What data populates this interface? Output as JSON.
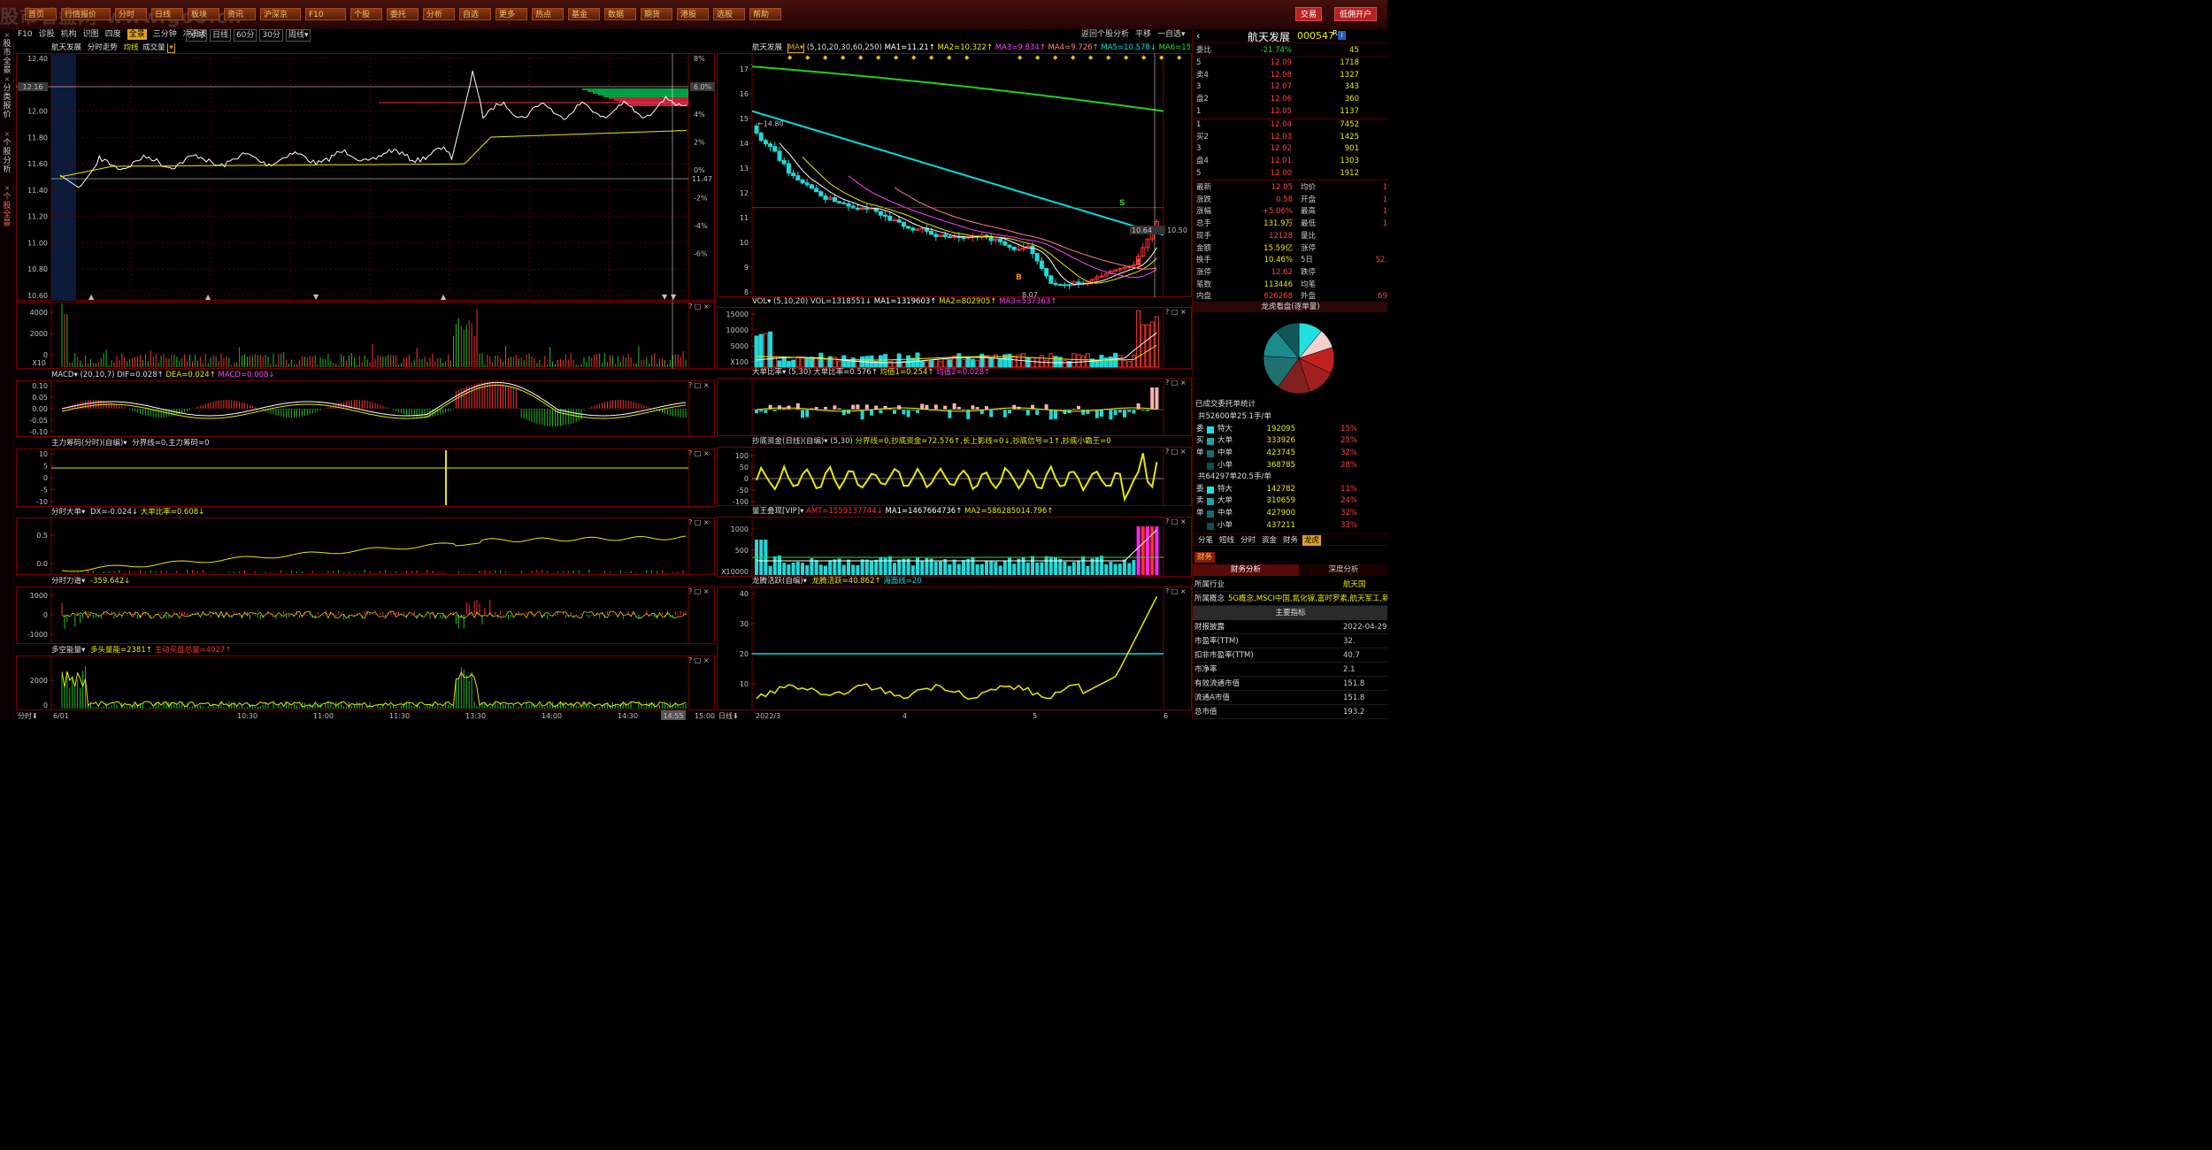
{
  "app": {
    "watermark": "股市看盘网-www.goo.cn",
    "trade_button": "交易",
    "open_account_button": "低佣开户"
  },
  "top_buttons": [
    "首页",
    "行情报价",
    "分时",
    "日线",
    "板块",
    "资讯",
    "沪深京",
    "F10",
    "个股",
    "委托",
    "分析",
    "自选",
    "更多",
    "热点",
    "基金",
    "数据",
    "期货",
    "港股",
    "选股",
    "帮助"
  ],
  "left_tabs": [
    {
      "label": "股市全景",
      "active": false
    },
    {
      "label": "分类报价",
      "active": false
    },
    {
      "label": "个股分析",
      "active": false
    },
    {
      "label": "个股全景",
      "active": true
    }
  ],
  "toolbar": {
    "items": [
      "F10",
      "诊股",
      "机构",
      "识图",
      "四度",
      "全景",
      "三分钟",
      "冲击波"
    ],
    "active": "全景",
    "tabs": [
      "分时",
      "日线",
      "60分",
      "30分",
      "周线▾"
    ],
    "right": [
      "返回个股分析",
      "平移",
      "一自选▾"
    ]
  },
  "intraday": {
    "header": {
      "name": "航天发展",
      "title": "分时走势",
      "avg_label": "均线",
      "vol_label": "成交量"
    },
    "price_ticks": [
      "12.40",
      "12.20",
      "12.00",
      "11.80",
      "11.60",
      "11.40",
      "11.20",
      "11.00",
      "10.80",
      "10.60"
    ],
    "pct_ticks": [
      "8%",
      "6%",
      "4%",
      "2%",
      "0%",
      "-2%",
      "-4%",
      "-6%"
    ],
    "cur_price_tag": "12.16",
    "cur_pct_tag": "6.0%",
    "prev_close_label": "11.47",
    "vol_ticks": [
      "4000",
      "2000",
      "0"
    ],
    "vol_unit": "X10",
    "macd": {
      "label": "MACD▾",
      "params": "(20,10,7)",
      "dif": "DIF=0.028↑",
      "dea": "DEA=0.024↑",
      "macd": "MACD=0.008↓",
      "ticks": [
        "0.10",
        "0.05",
        "0.00",
        "-0.05",
        "-0.10"
      ]
    },
    "main_chip": {
      "label": "主力筹码(分时)(自编)▾",
      "formula": "分界线=0,主力筹码=0",
      "ticks": [
        "10",
        "5",
        "0",
        "-5",
        "-10"
      ]
    },
    "big_order": {
      "label": "分时大单▾",
      "dx": "DX=-0.024↓",
      "ratio": "大单比率=0.608↓",
      "ticks": [
        "0.5",
        "0.0"
      ]
    },
    "force": {
      "label": "分时力道▾",
      "value": "-359.642↓",
      "ticks": [
        "1000",
        "0",
        "-1000"
      ]
    },
    "energy": {
      "label": "多空能量▾",
      "bull": "多头量能=2381↑",
      "bear": "主动买盘总量=4027↑",
      "ticks": [
        "2000",
        "0"
      ]
    },
    "time_labels": [
      "6/01",
      "10:30",
      "11:00",
      "11:30",
      "13:30",
      "14:00",
      "14:30",
      "15:00"
    ],
    "cursor_time": "14:55",
    "bottom_label": "分时⬇"
  },
  "daily": {
    "header": {
      "name": "航天发展",
      "ma_tag": "MA▾",
      "params": "(5,10,20,30,60,250)",
      "ma1": "MA1=11.21↑",
      "ma2": "MA2=10.322↑",
      "ma3": "MA3=9.834↑",
      "ma4": "MA4=9.726↑",
      "ma5": "MA5=10.578↓",
      "ma6": "MA6=15.709↓"
    },
    "price_ticks": [
      "17",
      "16",
      "15",
      "14",
      "13",
      "12",
      "11",
      "10",
      "9",
      "8"
    ],
    "annotations": {
      "high": "14.80",
      "low": "8.07",
      "last": "10.50",
      "now": "10.64",
      "sell": "S",
      "buy": "B"
    },
    "vol": {
      "label": "VOL▾",
      "params": "(5,10,20)",
      "vol": "VOL=1318551↓",
      "ma1": "MA1=1319603↑",
      "ma2": "MA2=802905↑",
      "ma3": "MA3=537363↑",
      "ticks": [
        "15000",
        "10000",
        "5000",
        "X100"
      ]
    },
    "big_ratio": {
      "label": "大单比率▾",
      "params": "(5,30)",
      "ratio": "大单比率=0.576↑",
      "avg1": "均值1=0.254↑",
      "avg2": "均值2=0.028↑"
    },
    "bottom_fund": {
      "label": "抄底资金(日线)(自编)▾",
      "params": "(5,30)",
      "formula": "分界线=0,抄底资金=72.576↑,长上影线=0↓,抄底信号=1↑,抄底小霸王=0",
      "ticks": [
        "100",
        "50",
        "0",
        "-50",
        "-100"
      ]
    },
    "qty": {
      "label": "量王叠现[VIP]▾",
      "amt": "AMT=1559137744↓",
      "ma1": "MA1=1467664736↑",
      "ma2": "MA2=586285014.796↑",
      "ticks": [
        "1000",
        "500",
        "X10000"
      ]
    },
    "dragon": {
      "label": "龙腾活跃(自编)▾",
      "value": "龙腾活跃=40.862↑",
      "line": "海面线=20",
      "ticks": [
        "40",
        "30",
        "20",
        "10"
      ]
    },
    "months": [
      "2022/3",
      "4",
      "5",
      "6"
    ],
    "bottom_label": "日线⬇"
  },
  "right_panel": {
    "title": "航天发展",
    "code": "000547",
    "r": "R",
    "ratio": {
      "label": "委比",
      "value": "-21.74%",
      "vol": "45"
    },
    "sell": [
      {
        "k": "5",
        "p": "12.09",
        "v": "1718"
      },
      {
        "k": "卖4",
        "p": "12.08",
        "v": "1327"
      },
      {
        "k": "3",
        "p": "12.07",
        "v": "343"
      },
      {
        "k": "盘2",
        "p": "12.06",
        "v": "360"
      },
      {
        "k": "1",
        "p": "12.05",
        "v": "1137"
      }
    ],
    "buy": [
      {
        "k": "1",
        "p": "12.04",
        "v": "7452"
      },
      {
        "k": "买2",
        "p": "12.03",
        "v": "1425"
      },
      {
        "k": "3",
        "p": "12.02",
        "v": "901"
      },
      {
        "k": "盘4",
        "p": "12.01",
        "v": "1303"
      },
      {
        "k": "5",
        "p": "12.00",
        "v": "1912"
      }
    ],
    "stats": [
      {
        "k": "最新",
        "v": "12.05",
        "k2": "均价",
        "v2": "1"
      },
      {
        "k": "涨跌",
        "v": "0.58",
        "k2": "开盘",
        "v2": "1"
      },
      {
        "k": "涨幅",
        "v": "+5.06%",
        "k2": "最高",
        "v2": "1"
      },
      {
        "k": "总手",
        "v": "131.9万",
        "k2": "最低",
        "v2": "1"
      },
      {
        "k": "现手",
        "v": "12128",
        "k2": "量比",
        "v2": ""
      },
      {
        "k": "金额",
        "v": "15.59亿",
        "k2": "涨停",
        "v2": ""
      },
      {
        "k": "换手",
        "v": "10.46%",
        "k2": "5日",
        "v2": "52."
      },
      {
        "k": "涨停",
        "v": "12.62",
        "k2": "跌停",
        "v2": ""
      },
      {
        "k": "笔数",
        "v": "113446",
        "k2": "均笔",
        "v2": ""
      },
      {
        "k": "内盘",
        "v": "626268",
        "k2": "外盘",
        "v2": "69"
      }
    ],
    "pie_title": "龙虎看盘(逐单量)",
    "entrust": {
      "title": "已成交委托单统计",
      "buy_total": "共52600单25.1手/单",
      "sell_total": "共64297单20.5手/单",
      "buy_rows": [
        {
          "side": "委",
          "k": "特大",
          "v": "192095",
          "p": "15%"
        },
        {
          "side": "买",
          "k": "大单",
          "v": "333926",
          "p": "25%"
        },
        {
          "side": "单",
          "k": "中单",
          "v": "423745",
          "p": "32%"
        },
        {
          "side": "",
          "k": "小单",
          "v": "368785",
          "p": "28%"
        }
      ],
      "sell_rows": [
        {
          "side": "委",
          "k": "特大",
          "v": "142782",
          "p": "11%"
        },
        {
          "side": "卖",
          "k": "大单",
          "v": "310659",
          "p": "24%"
        },
        {
          "side": "单",
          "k": "中单",
          "v": "427900",
          "p": "32%"
        },
        {
          "side": "",
          "k": "小单",
          "v": "437211",
          "p": "33%"
        }
      ]
    },
    "tabs": [
      "分笔",
      "短线",
      "分时",
      "资金",
      "财务",
      "龙虎"
    ],
    "active_tab": "龙虎",
    "fin_tab": "财务",
    "fin_sub": [
      "财务分析",
      "深度分析"
    ],
    "fin": [
      {
        "k": "所属行业",
        "v": "航天国"
      },
      {
        "k": "所属概念",
        "v": "5G概念,MSCI中国,氮化镓,富时罗素,航天军工,新"
      },
      {
        "k": "",
        "v": "主要指标",
        "head": true
      },
      {
        "k": "财报披露",
        "v": "2022-04-29"
      },
      {
        "k": "市盈率(TTM)",
        "v": "32."
      },
      {
        "k": "扣非市盈率(TTM)",
        "v": "40.7"
      },
      {
        "k": "市净率",
        "v": "2.1"
      },
      {
        "k": "有效流通市值",
        "v": "151.8"
      },
      {
        "k": "流通A市值",
        "v": "151.8"
      },
      {
        "k": "总市值",
        "v": "193.2"
      }
    ]
  },
  "colors": {
    "up": "#ff3030",
    "down": "#20d0d0",
    "yellow": "#e8e800",
    "grid": "#5a0000",
    "frame": "#7a0000",
    "ma_green": "#20d020",
    "ma_cyan": "#00e0e0",
    "magenta": "#ff20ff"
  }
}
